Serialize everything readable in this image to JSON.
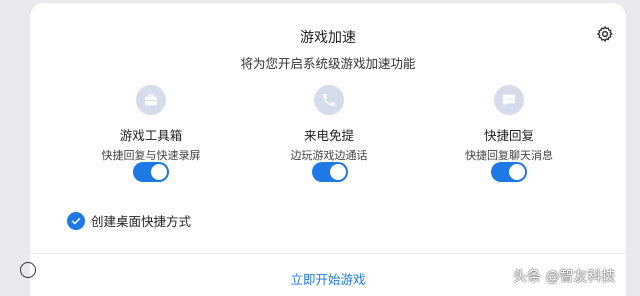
{
  "dialog": {
    "title": "游戏加速",
    "subtitle": "将为您开启系统级游戏加速功能",
    "settings_icon": "gear-icon",
    "features": [
      {
        "icon": "briefcase-icon",
        "name": "游戏工具箱",
        "description": "快捷回复与快速录屏",
        "enabled": true
      },
      {
        "icon": "phone-icon",
        "name": "来电免提",
        "description": "边玩游戏边通话",
        "enabled": true
      },
      {
        "icon": "chat-bubble-icon",
        "name": "快捷回复",
        "description": "快捷回复聊天消息",
        "enabled": true
      }
    ],
    "shortcut_checkbox": {
      "label": "创建桌面快捷方式",
      "checked": true
    },
    "start_button": "立即开始游戏"
  },
  "watermark": "头条 @智友科技",
  "colors": {
    "accent": "#1e78e6",
    "icon_bg": "#d6dcec",
    "background": "#e9eaee"
  }
}
